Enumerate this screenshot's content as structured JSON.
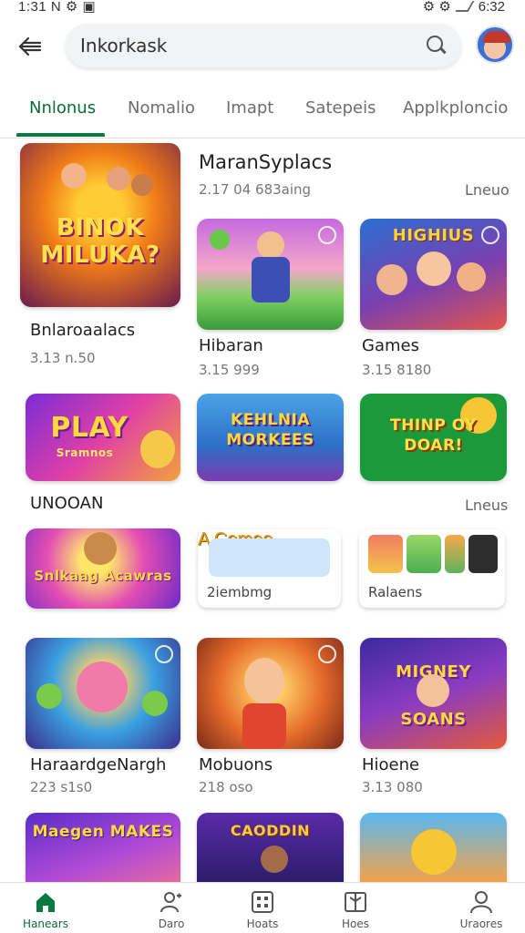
{
  "status_bar": {
    "time": "1:31 N ⚙ ▣",
    "right_icons": "⚙ ⚙",
    "clock": "6:32"
  },
  "header": {
    "search_query": "Inkorkask",
    "icons": {
      "back": "back-arrow-icon",
      "search": "search-icon",
      "avatar": "profile-avatar"
    }
  },
  "tabs": [
    {
      "label": "Nnlonus",
      "active": true
    },
    {
      "label": "Nomalio",
      "active": false
    },
    {
      "label": "Imapt",
      "active": false
    },
    {
      "label": "Satepeis",
      "active": false
    },
    {
      "label": "Applkploncio",
      "active": false
    }
  ],
  "featured": {
    "title_art": "BINOK MILUKA?",
    "label": "Bnlaroaalacs",
    "meta": "3.13 n.50"
  },
  "section1": {
    "title": "MaranSyplacs",
    "subtitle": "2.17 04 683aing",
    "more": "Lneuo",
    "items": [
      {
        "art": "",
        "label": "Hibaran",
        "meta": "3.15 999"
      },
      {
        "art": "HIGHIUS",
        "label": "Games",
        "meta": "3.15 8180"
      }
    ]
  },
  "row2": [
    {
      "art": "PLAY",
      "sub": "Sramnos"
    },
    {
      "art": "KEHLNIA MORKEES"
    },
    {
      "art": "THINP OY DOAR!"
    }
  ],
  "section2": {
    "title": "UNOOAN",
    "more": "Lneus",
    "items": [
      {
        "art": "Snlkaag Acawras"
      },
      {
        "art": "A Comee",
        "label": "2iembmg"
      },
      {
        "label": "Ralaens"
      }
    ]
  },
  "row4": [
    {
      "label": "HaraardgeNargh",
      "meta": "223 s1s0"
    },
    {
      "label": "Mobuons",
      "meta": "218 oso"
    },
    {
      "art": "MIGNEY SOANS",
      "label": "Hioene",
      "meta": "3.13 080"
    }
  ],
  "row5": [
    {
      "art": "Maegen MAKES"
    },
    {
      "art": "CAODDIN"
    },
    {
      "art": ""
    }
  ],
  "nav": [
    {
      "label": "Hanears",
      "icon": "home-icon",
      "active": true
    },
    {
      "label": "Daro",
      "icon": "people-icon",
      "active": false
    },
    {
      "label": "Hoats",
      "icon": "grid-icon",
      "active": false
    },
    {
      "label": "Hoes",
      "icon": "book-icon",
      "active": false
    },
    {
      "label": "Uraores",
      "icon": "person-icon",
      "active": false
    }
  ],
  "colors": {
    "accent": "#0a7a42"
  }
}
